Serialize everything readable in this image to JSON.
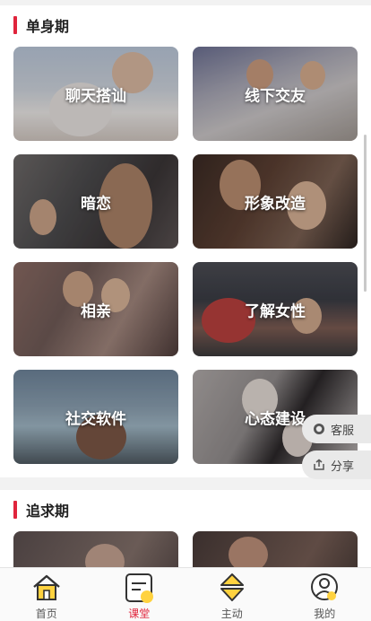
{
  "sections": [
    {
      "title": "单身期",
      "cards": [
        "聊天搭讪",
        "线下交友",
        "暗恋",
        "形象改造",
        "相亲",
        "了解女性",
        "社交软件",
        "心态建设"
      ]
    },
    {
      "title": "追求期",
      "cards": []
    }
  ],
  "floating": {
    "service_label": "客服",
    "share_label": "分享"
  },
  "tabbar": {
    "items": [
      {
        "label": "首页",
        "icon": "home-icon"
      },
      {
        "label": "课堂",
        "icon": "classroom-icon"
      },
      {
        "label": "主动",
        "icon": "proactive-icon"
      },
      {
        "label": "我的",
        "icon": "profile-icon"
      }
    ],
    "active_index": 1
  },
  "colors": {
    "accent": "#e0243c",
    "icon_yellow": "#ffd23f"
  }
}
